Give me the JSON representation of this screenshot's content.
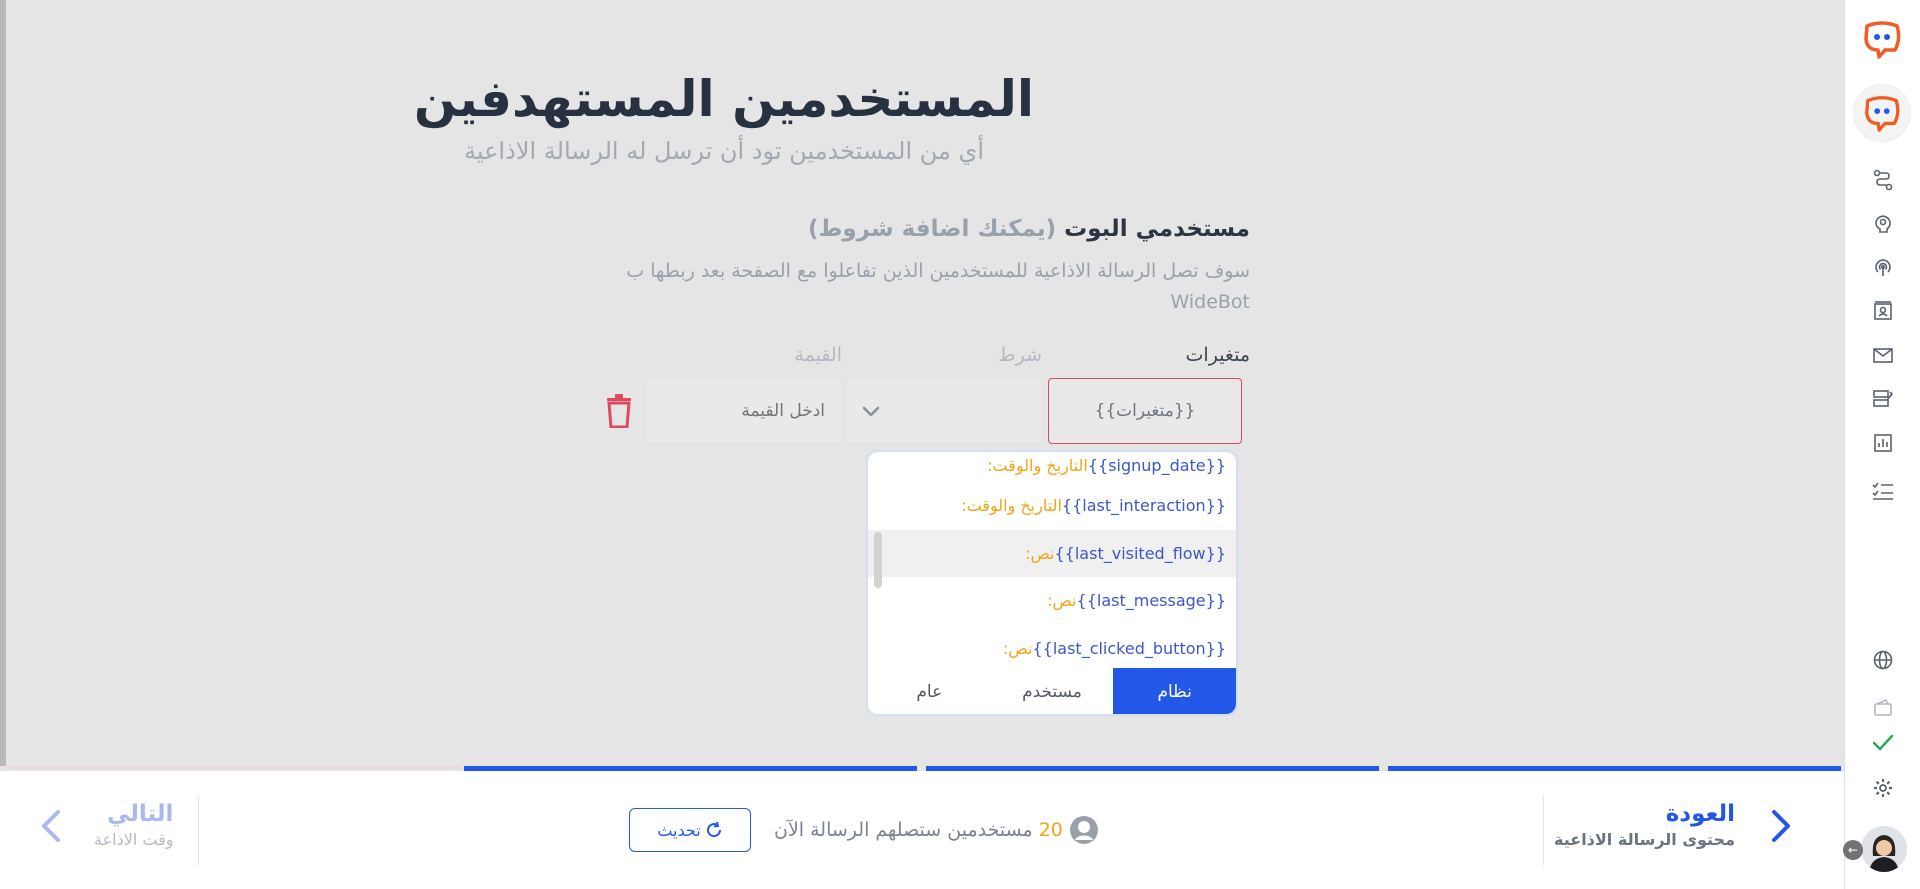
{
  "header": {
    "title": "المستخدمين المستهدفين",
    "subtitle": "أي من المستخدمين تود أن ترسل له الرسالة الاذاعية"
  },
  "section": {
    "title": "مستخدمي البوت",
    "hint": "(يمكنك اضافة شروط)",
    "description": "سوف تصل الرسالة الاذاعية للمستخدمين الذين تفاعلوا مع الصفحة بعد ربطها ب WideBot"
  },
  "filter": {
    "variables_label": "متغيرات",
    "condition_label": "شرط",
    "value_label": "القيمة",
    "variables_value": "{{متغيرات}}",
    "value_placeholder": "ادخل القيمة"
  },
  "dropdown": {
    "items": [
      {
        "name": "{{signup_date}}",
        "type": ":التاريخ والوقت"
      },
      {
        "name": "{{last_interaction}}",
        "type": ":التاريخ والوقت"
      },
      {
        "name": "{{last_visited_flow}}",
        "type": ":نص"
      },
      {
        "name": "{{last_message}}",
        "type": ":نص"
      },
      {
        "name": "{{last_clicked_button}}",
        "type": ":نص"
      }
    ],
    "active_index": 2,
    "tabs": [
      {
        "label": "نظام",
        "selected": true
      },
      {
        "label": "مستخدم",
        "selected": false
      },
      {
        "label": "عام",
        "selected": false
      }
    ]
  },
  "footer": {
    "back_title": "العودة",
    "back_subtitle": "محتوى الرسالة الاذاعية",
    "next_title": "التالي",
    "next_subtitle": "وقت الاذاعة",
    "users_count": "20",
    "users_text": "مستخدمين ستصلهم الرسالة الآن",
    "refresh_label": "تحديث"
  },
  "sidebar": {
    "icons": [
      "widebot-logo-icon",
      "bot-avatar-icon",
      "flows-icon",
      "ai-brain-icon",
      "broadcast-icon",
      "contacts-icon",
      "inbox-icon",
      "templates-icon",
      "analytics-icon",
      "tasks-icon",
      "globe-icon",
      "wallet-icon",
      "check-icon",
      "settings-icon"
    ]
  },
  "colors": {
    "primary": "#2357e8",
    "accent_orange": "#f0a416",
    "danger": "#e0485f",
    "variable_blue": "#3c57c9"
  }
}
